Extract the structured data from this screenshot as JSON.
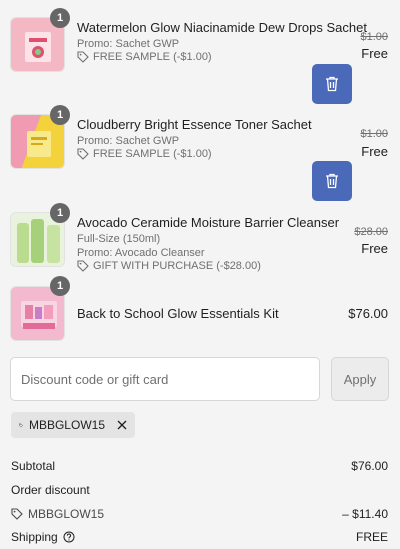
{
  "items": [
    {
      "quantity": "1",
      "title": "Watermelon Glow Niacinamide Dew Drops Sachet",
      "promo": "Promo: Sachet GWP",
      "tag": "FREE SAMPLE (-$1.00)",
      "original_price": "$1.00",
      "price": "Free",
      "removable": true,
      "thumb_color": "#f4b8c4"
    },
    {
      "quantity": "1",
      "title": "Cloudberry Bright Essence Toner Sachet",
      "promo": "Promo: Sachet GWP",
      "tag": "FREE SAMPLE (-$1.00)",
      "original_price": "$1.00",
      "price": "Free",
      "removable": true,
      "thumb_color": "#f3d23b"
    },
    {
      "quantity": "1",
      "title": "Avocado Ceramide Moisture Barrier Cleanser",
      "variant": "Full-Size (150ml)",
      "promo": "Promo: Avocado Cleanser",
      "tag": "GIFT WITH PURCHASE (-$28.00)",
      "original_price": "$28.00",
      "price": "Free",
      "removable": false,
      "thumb_color": "#cfe7b8"
    },
    {
      "quantity": "1",
      "title": "Back to School Glow Essentials Kit",
      "price": "$76.00",
      "removable": false,
      "thumb_color": "#f3b9cf"
    }
  ],
  "discount": {
    "placeholder": "Discount code or gift card",
    "apply_label": "Apply",
    "applied_code": "MBBGLOW15"
  },
  "summary": {
    "subtotal_label": "Subtotal",
    "subtotal_value": "$76.00",
    "order_discount_label": "Order discount",
    "discount_code": "MBBGLOW15",
    "discount_value": "– $11.40",
    "shipping_label": "Shipping",
    "shipping_value": "FREE"
  },
  "colors": {
    "accent": "#4a69b8",
    "background": "#f4f4f4",
    "badge": "#666666"
  }
}
